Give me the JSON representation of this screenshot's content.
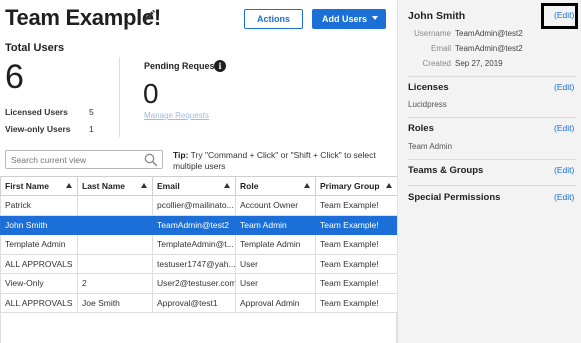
{
  "header": {
    "title": "Team Example!",
    "actions_label": "Actions",
    "add_users_label": "Add Users"
  },
  "stats": {
    "total_users_label": "Total Users",
    "total_users_value": "6",
    "licensed_label": "Licensed Users",
    "licensed_value": "5",
    "viewonly_label": "View-only Users",
    "viewonly_value": "1",
    "pending_label": "Pending Requests",
    "pending_value": "0",
    "manage_requests_label": "Manage Requests"
  },
  "search": {
    "placeholder": "Search current view"
  },
  "tip": {
    "prefix": "Tip:",
    "text": " Try \"Command + Click\" or \"Shift + Click\" to select multiple users"
  },
  "table": {
    "columns": [
      "First Name",
      "Last Name",
      "Email",
      "Role",
      "Primary Group"
    ],
    "rows": [
      {
        "first": "Patrick",
        "last": "",
        "email": "pcollier@mailinato...",
        "role": "Account Owner",
        "group": "Team Example!"
      },
      {
        "first": "John Smith",
        "last": "",
        "email": "TeamAdmin@test2",
        "role": "Team Admin",
        "group": "Team Example!"
      },
      {
        "first": "Template Admin",
        "last": "",
        "email": "TemplateAdmin@t...",
        "role": "Template Admin",
        "group": "Team Example!"
      },
      {
        "first": "ALL APPROVALS",
        "last": "",
        "email": "testuser1747@yah...",
        "role": "User",
        "group": "Team Example!"
      },
      {
        "first": "View-Only",
        "last": "2",
        "email": "User2@testuser.com",
        "role": "User",
        "group": "Team Example!"
      },
      {
        "first": "ALL APPROVALS",
        "last": "Joe Smith",
        "email": "Approval@test1",
        "role": "Approval Admin",
        "group": "Team Example!"
      }
    ]
  },
  "details": {
    "name": "John Smith",
    "edit_label": "(Edit)",
    "username_label": "Username",
    "username_value": "TeamAdmin@test2",
    "email_label": "Email",
    "email_value": "TeamAdmin@test2",
    "created_label": "Created",
    "created_value": "Sep 27, 2019",
    "licenses_label": "Licenses",
    "licenses_value": "Lucidpress",
    "roles_label": "Roles",
    "roles_value": "Team Admin",
    "teams_label": "Teams & Groups",
    "special_label": "Special Permissions"
  },
  "colors": {
    "accent": "#1b6fd6",
    "selected_row": "#1b6fd6",
    "sidebar_bg": "#f3f3f3"
  },
  "icons": [
    "pencil-icon",
    "dropdown-caret-icon",
    "info-icon",
    "search-icon",
    "sort-arrow-icon"
  ]
}
